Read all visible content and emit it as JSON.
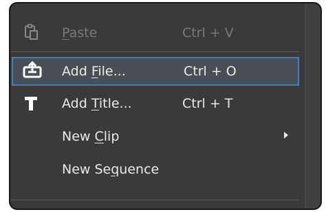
{
  "menu": {
    "items": [
      {
        "before": "",
        "mnemonic": "P",
        "after": "aste",
        "shortcut": "Ctrl + V",
        "icon": "paste-icon",
        "state": "disabled"
      },
      {
        "before": "Add ",
        "mnemonic": "F",
        "after": "ile...",
        "shortcut": "Ctrl + O",
        "icon": "add-file-icon",
        "state": "selected"
      },
      {
        "before": "Add ",
        "mnemonic": "T",
        "after": "itle...",
        "shortcut": "Ctrl + T",
        "icon": "title-icon",
        "state": "normal"
      },
      {
        "before": "New ",
        "mnemonic": "C",
        "after": "lip",
        "shortcut": "",
        "icon": "submenu-arrow-icon",
        "state": "normal"
      },
      {
        "before": "New Se",
        "mnemonic": "q",
        "after": "uence",
        "shortcut": "",
        "icon": "",
        "state": "normal"
      }
    ]
  },
  "colors": {
    "menu_bg": "#3a3a3a",
    "selection_border": "#3f7fc6",
    "text": "#eaeaea",
    "disabled_text": "#7a7a7a"
  }
}
